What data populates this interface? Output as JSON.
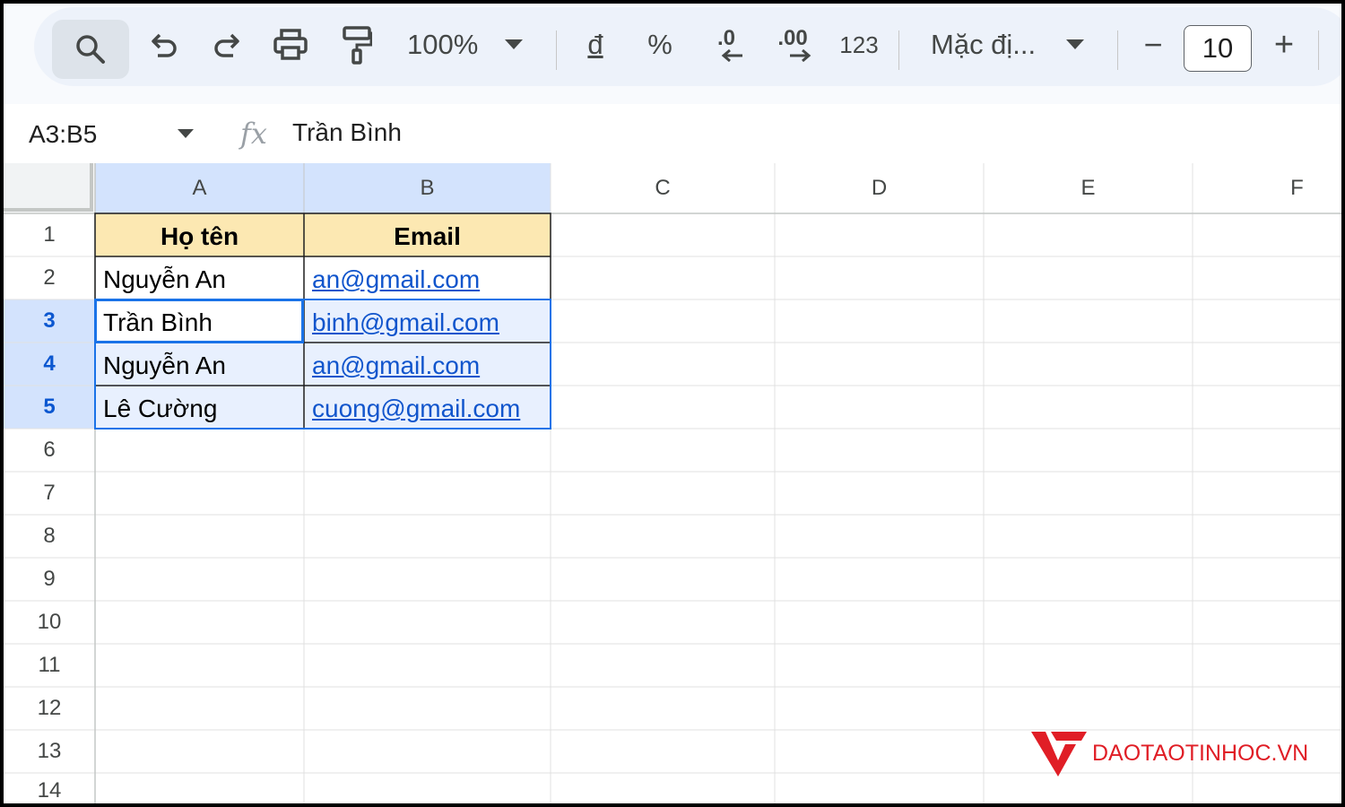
{
  "toolbar": {
    "zoom": "100%",
    "currency_symbol": "đ",
    "percent_symbol": "%",
    "decrease_decimal_label": ".0",
    "increase_decimal_label": ".00",
    "more_formats_label": "123",
    "font_name": "Mặc đị...",
    "font_size": "10",
    "minus_symbol": "−",
    "plus_symbol": "+"
  },
  "formula_bar": {
    "name_box": "A3:B5",
    "fx_label": "fx",
    "content": "Trần Bình"
  },
  "columns": [
    "A",
    "B",
    "C",
    "D",
    "E",
    "F"
  ],
  "rows": [
    "1",
    "2",
    "3",
    "4",
    "5",
    "6",
    "7",
    "8",
    "9",
    "10",
    "11",
    "12",
    "13",
    "14"
  ],
  "cells": {
    "A1": "Họ tên",
    "B1": "Email",
    "A2": "Nguyễn An",
    "B2": "an@gmail.com",
    "A3": "Trần Bình",
    "B3": "binh@gmail.com",
    "A4": "Nguyễn An",
    "B4": "an@gmail.com",
    "A5": "Lê Cường",
    "B5": "cuong@gmail.com"
  },
  "selection": {
    "range": "A3:B5",
    "active_cell": "A3"
  },
  "colors": {
    "header_fill": "#fce8b2",
    "selection_fill": "#e8f0fe",
    "selection_border": "#1a73e8",
    "link": "#1155cc",
    "brand": "#e01e26"
  },
  "watermark": {
    "text": "DAOTAOTINHOC.VN"
  }
}
